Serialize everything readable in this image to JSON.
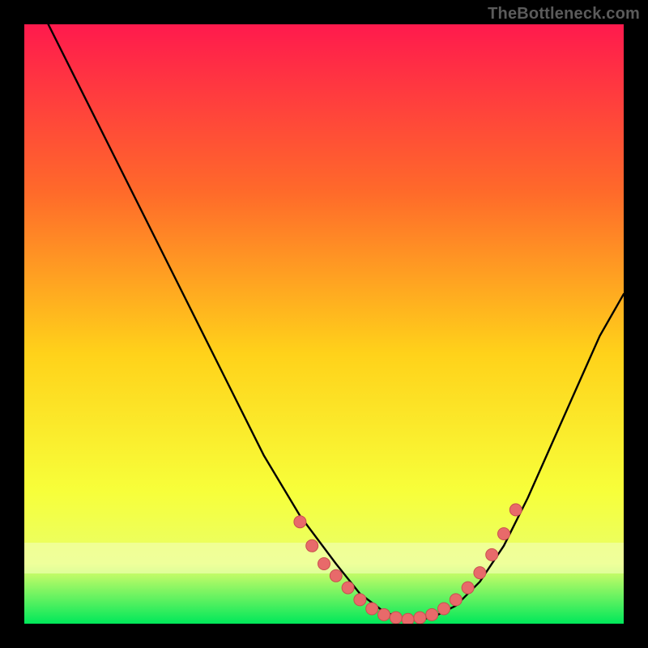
{
  "watermark": "TheBottleneck.com",
  "colors": {
    "black": "#000000",
    "curve": "#000000",
    "marker_fill": "#e86a6a",
    "marker_stroke": "#c94f4f",
    "grad_top": "#ff1a4d",
    "grad_mid1": "#ff7a1f",
    "grad_mid2": "#ffd21a",
    "grad_mid3": "#f7ff3a",
    "grad_band": "#e8ff6a",
    "grad_bottom": "#00e85a"
  },
  "chart_data": {
    "type": "line",
    "title": "",
    "xlabel": "",
    "ylabel": "",
    "xlim": [
      0,
      100
    ],
    "ylim": [
      0,
      100
    ],
    "note": "Axis-less V-shaped bottleneck curve over a red→green vertical gradient. Values are approximate percentages read from vertical position where 0 = top, 100 = bottom of the plot area.",
    "series": [
      {
        "name": "curve",
        "x": [
          4,
          10,
          16,
          22,
          28,
          34,
          40,
          46,
          52,
          56,
          60,
          64,
          68,
          72,
          76,
          80,
          84,
          88,
          92,
          96,
          100
        ],
        "y": [
          0,
          12,
          24,
          36,
          48,
          60,
          72,
          82,
          90,
          95,
          98,
          99.5,
          99,
          97,
          93,
          87,
          79,
          70,
          61,
          52,
          45
        ]
      }
    ],
    "markers": {
      "name": "highlighted-range",
      "x": [
        46,
        48,
        50,
        52,
        54,
        56,
        58,
        60,
        62,
        64,
        66,
        68,
        70,
        72,
        74,
        76,
        78,
        80,
        82
      ],
      "y": [
        83,
        87,
        90,
        92,
        94,
        96,
        97.5,
        98.5,
        99,
        99.3,
        99,
        98.5,
        97.5,
        96,
        94,
        91.5,
        88.5,
        85,
        81
      ]
    }
  }
}
